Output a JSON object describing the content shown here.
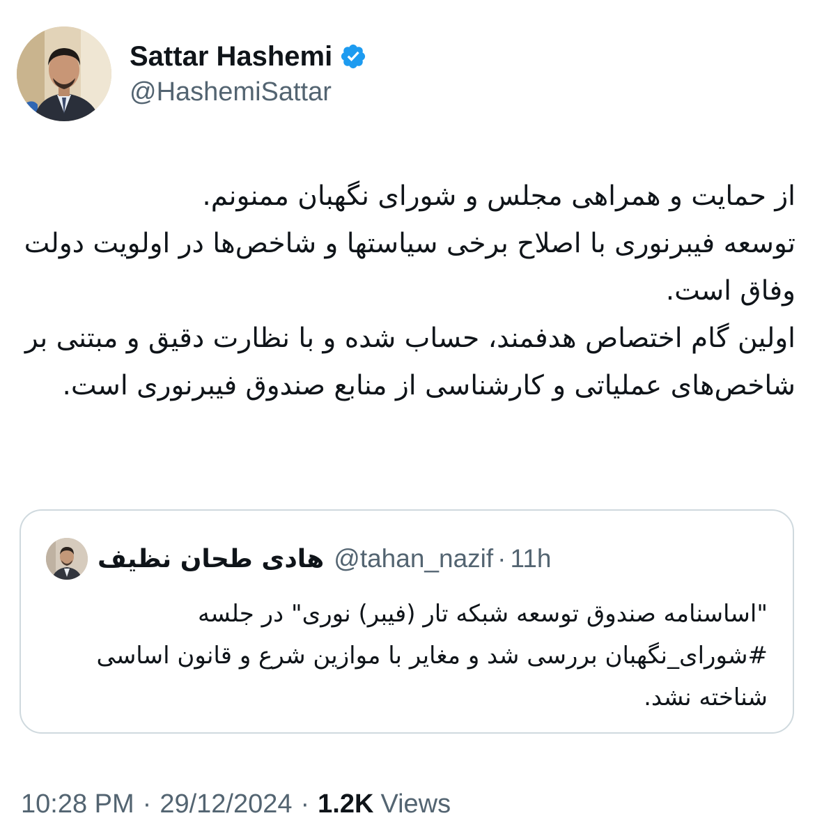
{
  "author": {
    "display_name": "Sattar Hashemi",
    "handle": "@HashemiSattar",
    "verified": true,
    "avatar_icon": "profile-photo"
  },
  "tweet": {
    "text": "از حمایت و همراهی مجلس و شورای نگهبان ممنونم.\nتوسعه فیبرنوری با اصلاح برخی سیاستها و شاخص‌ها در اولویت دولت وفاق است.\nاولین گام اختصاص هدفمند، حساب شده و با نظارت دقیق و مبتنی بر شاخص‌های عملیاتی و کارشناسی از منابع صندوق فیبرنوری است."
  },
  "quoted_tweet": {
    "display_name": "هادی طحان نظیف",
    "handle": "@tahan_nazif",
    "separator": "·",
    "time": "11h",
    "text": "\"اساسنامه صندوق توسعه شبکه تار (فیبر) نوری\" در جلسه #شورای_نگهبان بررسی شد و مغایر با موازین شرع و قانون اساسی شناخته نشد."
  },
  "meta": {
    "time": "10:28 PM",
    "separator": "·",
    "date": "29/12/2024",
    "views_count": "1.2K",
    "views_label": "Views"
  },
  "colors": {
    "text_primary": "#0f1419",
    "text_secondary": "#536471",
    "verified_blue": "#1d9bf0",
    "border": "#cfd9de"
  }
}
